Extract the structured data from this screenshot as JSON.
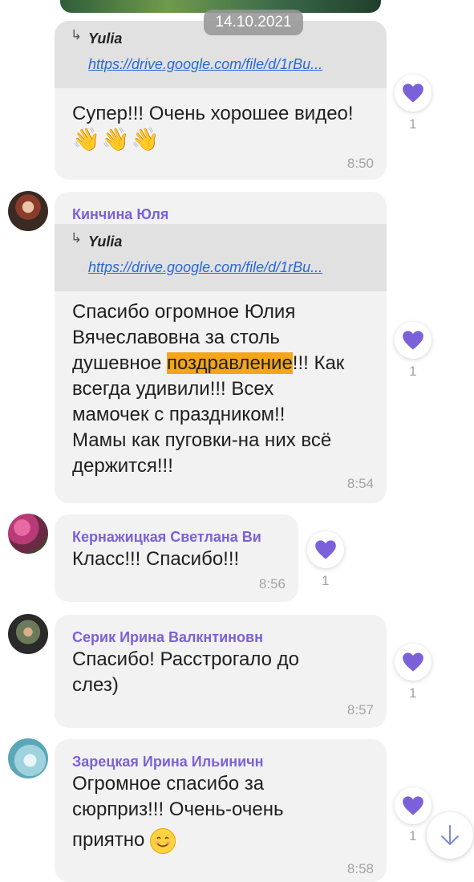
{
  "date_chip": "14.10.2021",
  "messages": [
    {
      "sender": "",
      "quote_name": "Yulia",
      "quote_link": "https://drive.google.com/file/d/1rBu...",
      "text": "Супер!!! Очень хорошее видео!",
      "emoji": "👋👋👋",
      "time": "8:50",
      "likes": "1",
      "like_icon": "heart-icon"
    },
    {
      "sender": "Кинчина Юля",
      "quote_name": "Yulia",
      "quote_link": "https://drive.google.com/file/d/1rBu...",
      "text_lines": [
        "Спасибо огромное Юлия",
        "Вячеславовна за столь"
      ],
      "text_line3_before": "душевное ",
      "highlight": "поздравление",
      "text_line3_after": "!!! Как",
      "text_lines_rest": [
        "всегда удивили!!! Всех",
        "мамочек с праздником!!",
        "Мамы как пуговки-на них всё",
        "держится!!!"
      ],
      "time": "8:54",
      "likes": "1"
    },
    {
      "sender": "Кернажицкая Светлана Ви",
      "text": "Класс!!! Спасибо!!!",
      "time": "8:56",
      "likes": "1"
    },
    {
      "sender": "Серик Ирина Валкнтиновн",
      "text_lines": [
        "Спасибо! Расстрогало до",
        "слез)"
      ],
      "time": "8:57",
      "likes": "1"
    },
    {
      "sender": "Зарецкая Ирина Ильиничн",
      "text_lines": [
        "Огромное спасибо за",
        "сюрприз!!! Очень-очень",
        "приятно"
      ],
      "emoji_icon": "smiling-face-icon",
      "time": "8:58",
      "likes": "1"
    }
  ],
  "colors": {
    "accent": "#7b61d9",
    "bubble": "#f2f2f3",
    "quote_bg": "#e1e1e2",
    "highlight": "#f5a51a",
    "link": "#2868d8"
  }
}
